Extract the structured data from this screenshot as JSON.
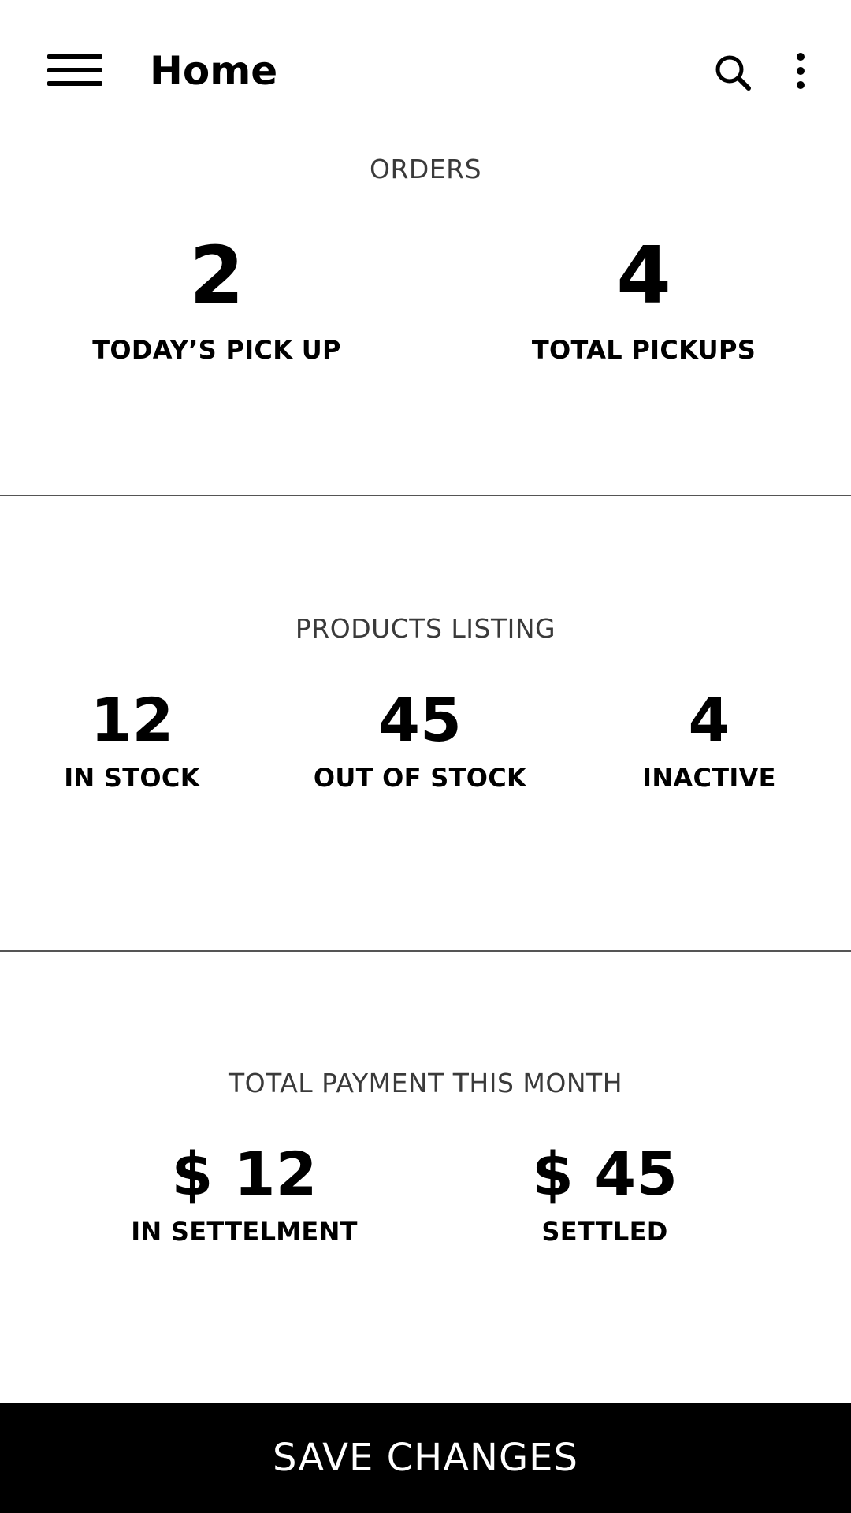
{
  "appbar": {
    "title": "Home",
    "menu_icon": "hamburger-menu-icon",
    "search_icon": "search-icon",
    "more_icon": "more-vertical-icon"
  },
  "orders": {
    "title": "ORDERS",
    "stats": [
      {
        "value": "2",
        "label": "TODAY’S PICK UP"
      },
      {
        "value": "4",
        "label": "TOTAL PICKUPS"
      }
    ]
  },
  "products": {
    "title": "PRODUCTS LISTING",
    "stats": [
      {
        "value": "12",
        "label": "IN STOCK"
      },
      {
        "value": "45",
        "label": "OUT OF STOCK"
      },
      {
        "value": "4",
        "label": "INACTIVE"
      }
    ]
  },
  "payments": {
    "title": "TOTAL PAYMENT THIS MONTH",
    "stats": [
      {
        "value": "$ 12",
        "label": "IN SETTELMENT"
      },
      {
        "value": "$ 45",
        "label": "SETTLED"
      }
    ]
  },
  "footer": {
    "save_label": "SAVE CHANGES"
  },
  "colors": {
    "background": "#ffffff",
    "text": "#000000",
    "section_title": "#3a3a3a",
    "button_bg": "#000000",
    "button_text": "#ffffff"
  }
}
